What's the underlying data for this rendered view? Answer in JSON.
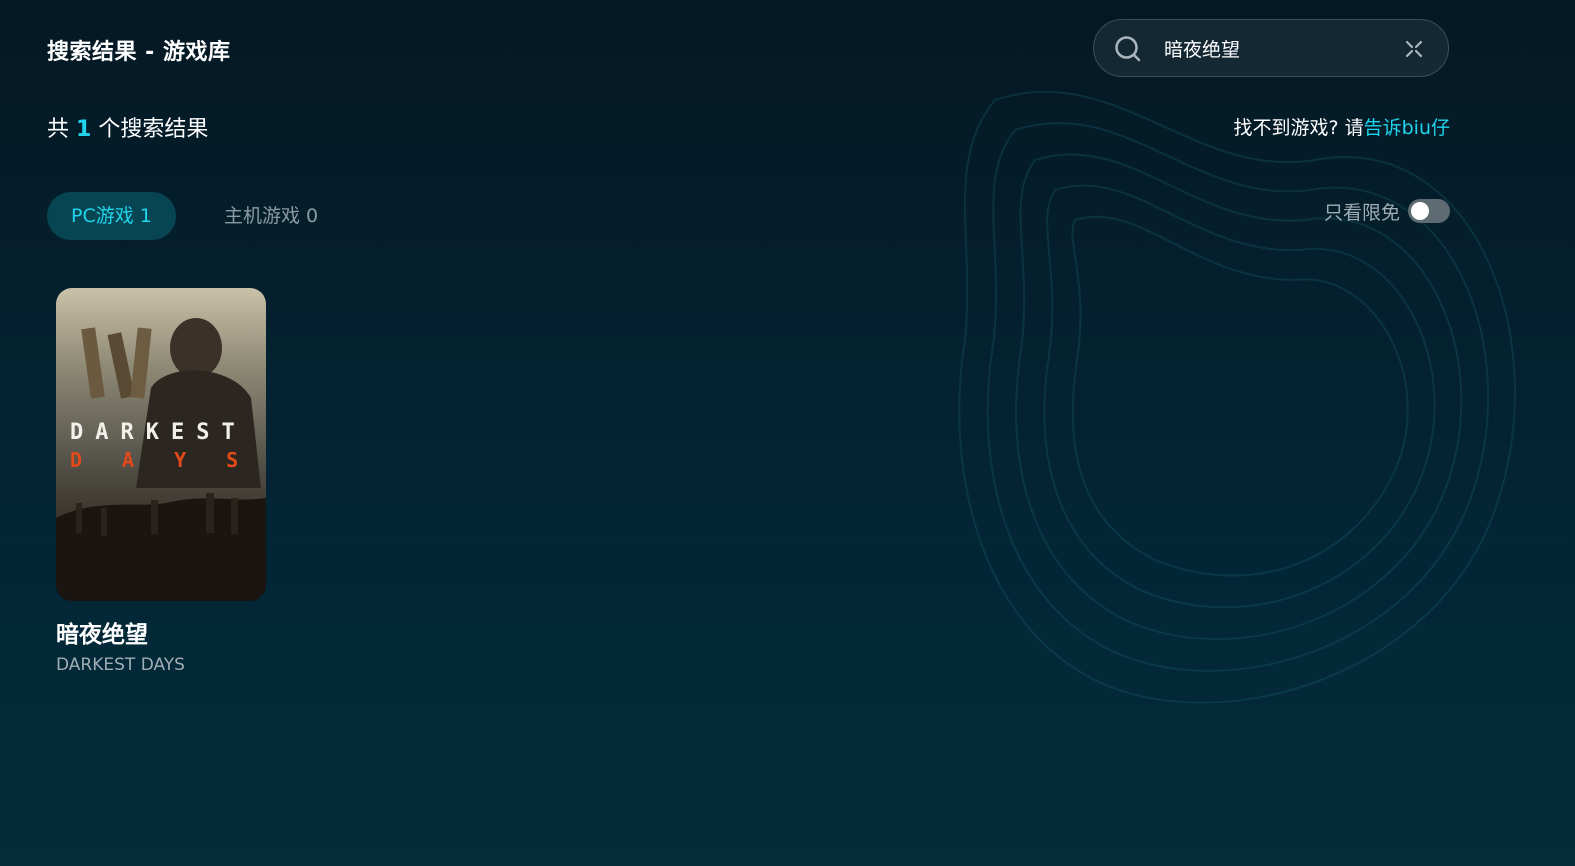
{
  "header": {
    "title": "搜索结果 - 游戏库"
  },
  "search": {
    "value": "暗夜绝望",
    "search_icon": "search-icon",
    "clear_icon": "close-icon"
  },
  "results": {
    "prefix": "共",
    "count": "1",
    "suffix": "个搜索结果"
  },
  "help": {
    "text": "找不到游戏? 请",
    "link": "告诉biu仔"
  },
  "tabs": [
    {
      "label": "PC游戏 1",
      "active": true
    },
    {
      "label": "主机游戏 0",
      "active": false
    }
  ],
  "filter": {
    "label": "只看限免",
    "enabled": false
  },
  "games": [
    {
      "name": "暗夜绝望",
      "english_name": "DARKEST DAYS",
      "cover_line1": "DARKEST",
      "cover_line2": "DAYS"
    }
  ],
  "colors": {
    "accent": "#1fd4ec",
    "tab_active_bg": "#074552",
    "background": "#04202f",
    "cover_title_red": "#e24a1a"
  }
}
